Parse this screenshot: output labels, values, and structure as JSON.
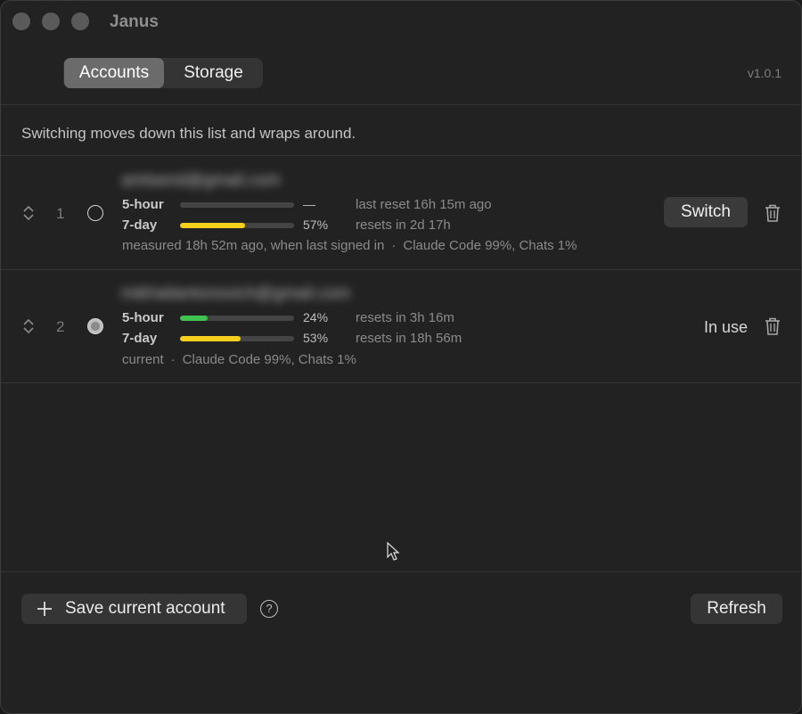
{
  "window": {
    "title": "Janus"
  },
  "tabs": [
    {
      "label": "Accounts",
      "active": true
    },
    {
      "label": "Storage",
      "active": false
    }
  ],
  "version": "v1.0.1",
  "hint": "Switching moves down this list and wraps around.",
  "accounts": [
    {
      "index": "1",
      "email": "amtsend@gmail.com",
      "selected": false,
      "five_hour": {
        "label": "5-hour",
        "percent": 0,
        "percent_text": "—",
        "reset": "last reset 16h 15m ago",
        "color": "#3fc24f"
      },
      "seven_day": {
        "label": "7-day",
        "percent": 57,
        "percent_text": "57%",
        "reset": "resets in 2d 17h",
        "color": "#f4d01c"
      },
      "meta_status": "measured 18h 52m ago, when last signed in",
      "meta_usage": "Claude Code 99%, Chats 1%",
      "action": "Switch"
    },
    {
      "index": "2",
      "email": "mikhailantonovich@gmail.com",
      "selected": true,
      "five_hour": {
        "label": "5-hour",
        "percent": 24,
        "percent_text": "24%",
        "reset": "resets in 3h 16m",
        "color": "#3fc24f"
      },
      "seven_day": {
        "label": "7-day",
        "percent": 53,
        "percent_text": "53%",
        "reset": "resets in 18h 56m",
        "color": "#f4d01c"
      },
      "meta_status": "current",
      "meta_usage": "Claude Code 99%, Chats 1%",
      "action": "In use"
    }
  ],
  "meta_separator": "·",
  "footer": {
    "save_label": "Save current account",
    "help_glyph": "?",
    "refresh_label": "Refresh"
  }
}
